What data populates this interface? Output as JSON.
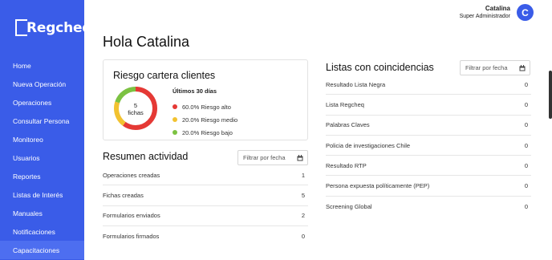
{
  "brand": {
    "logo_text": "Regcheq",
    "accent": "#3a5ce8"
  },
  "user": {
    "name": "Catalina",
    "role": "Super Administrador",
    "initial": "C"
  },
  "sidebar": {
    "items": [
      {
        "label": "Home"
      },
      {
        "label": "Nueva Operación"
      },
      {
        "label": "Operaciones"
      },
      {
        "label": "Consultar Persona"
      },
      {
        "label": "Monitoreo"
      },
      {
        "label": "Usuarios"
      },
      {
        "label": "Reportes"
      },
      {
        "label": "Listas de Interés"
      },
      {
        "label": "Manuales"
      },
      {
        "label": "Notificaciones"
      },
      {
        "label": "Capacitaciones"
      }
    ],
    "active_index": 10
  },
  "main": {
    "greeting": "Hola Catalina",
    "risk": {
      "title": "Riesgo cartera clientes",
      "donut_label_line1": "5",
      "donut_label_line2": "fichas",
      "period": "Últimos 30 días",
      "items": [
        {
          "label": "60.0% Riesgo alto",
          "percent": 60,
          "color": "#e53935"
        },
        {
          "label": "20.0% Riesgo medio",
          "percent": 20,
          "color": "#f2c230"
        },
        {
          "label": "20.0% Riesgo bajo",
          "percent": 20,
          "color": "#7cc242"
        }
      ]
    },
    "activity": {
      "title": "Resumen actividad",
      "filter_placeholder": "Filtrar por fecha",
      "rows": [
        {
          "label": "Operaciones creadas",
          "value": "1"
        },
        {
          "label": "Fichas creadas",
          "value": "5"
        },
        {
          "label": "Formularios enviados",
          "value": "2"
        },
        {
          "label": "Formularios firmados",
          "value": "0"
        }
      ]
    },
    "lists": {
      "title": "Listas con coincidencias",
      "filter_placeholder": "Filtrar por fecha",
      "rows": [
        {
          "label": "Resultado Lista Negra",
          "value": "0"
        },
        {
          "label": "Lista Regcheq",
          "value": "0"
        },
        {
          "label": "Palabras Claves",
          "value": "0"
        },
        {
          "label": "Policia de investigaciones Chile",
          "value": "0"
        },
        {
          "label": "Resultado RTP",
          "value": "0"
        },
        {
          "label": "Persona expuesta políticamente (PEP)",
          "value": "0"
        },
        {
          "label": "Screening Global",
          "value": "0"
        }
      ]
    }
  }
}
